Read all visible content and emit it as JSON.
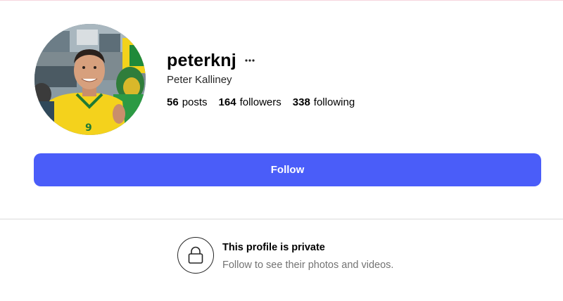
{
  "profile": {
    "username": "peterknj",
    "full_name": "Peter Kalliney",
    "more_icon": "ellipsis-icon",
    "avatar": "profile-photo"
  },
  "stats": {
    "posts": {
      "count": "56",
      "label": "posts"
    },
    "followers": {
      "count": "164",
      "label": "followers"
    },
    "following": {
      "count": "338",
      "label": "following"
    }
  },
  "actions": {
    "follow_label": "Follow"
  },
  "private_notice": {
    "icon": "lock-icon",
    "title": "This profile is private",
    "subtitle": "Follow to see their photos and videos."
  },
  "colors": {
    "follow_button": "#4a5df9",
    "divider": "#dbdbdb",
    "secondary_text": "#737373"
  }
}
